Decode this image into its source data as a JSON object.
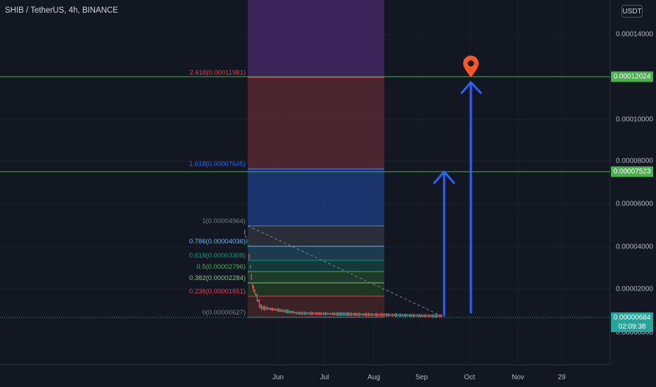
{
  "header": {
    "title": "SHIB / TetherUS, 4h, BINANCE",
    "currency": "USDT"
  },
  "price_axis": {
    "ticks": [
      "0.00014000",
      "0.00010000",
      "0.00008000",
      "0.00006000",
      "0.00004000",
      "0.00002000"
    ],
    "hidden_tick": "0.00000000"
  },
  "price_tags": {
    "upper_line": "0.00012024",
    "lower_line": "0.00007523",
    "last_price": "0.00000684",
    "countdown": "02:09:38"
  },
  "time_axis": {
    "ticks": [
      "Jun",
      "Jul",
      "Aug",
      "Sep",
      "Oct",
      "Nov",
      "29"
    ]
  },
  "fib_levels": [
    {
      "label": "2.618(0.00011981)",
      "color": "#f23645"
    },
    {
      "label": "1.618(0.00007645)",
      "color": "#2962ff"
    },
    {
      "label": "1(0.00004964)",
      "color": "#787b86"
    },
    {
      "label": "0.786(0.00004036)",
      "color": "#64b5f6"
    },
    {
      "label": "0.618(0.00003308)",
      "color": "#089981"
    },
    {
      "label": "0.5(0.00002796)",
      "color": "#4caf50"
    },
    {
      "label": "0.382(0.00002284)",
      "color": "#81c784"
    },
    {
      "label": "0.236(0.00001651)",
      "color": "#f23645"
    },
    {
      "label": "0(0.00000627)",
      "color": "#787b86"
    }
  ],
  "colors": {
    "background": "#131722",
    "horizontal_line": "#4caf50",
    "arrow": "#2962ff",
    "target_marker": "#ff5722",
    "candle_up": "#26a69a",
    "candle_down": "#ef5350"
  },
  "icons": {
    "target": "map-pin-icon",
    "arrow": "up-arrow-icon"
  }
}
